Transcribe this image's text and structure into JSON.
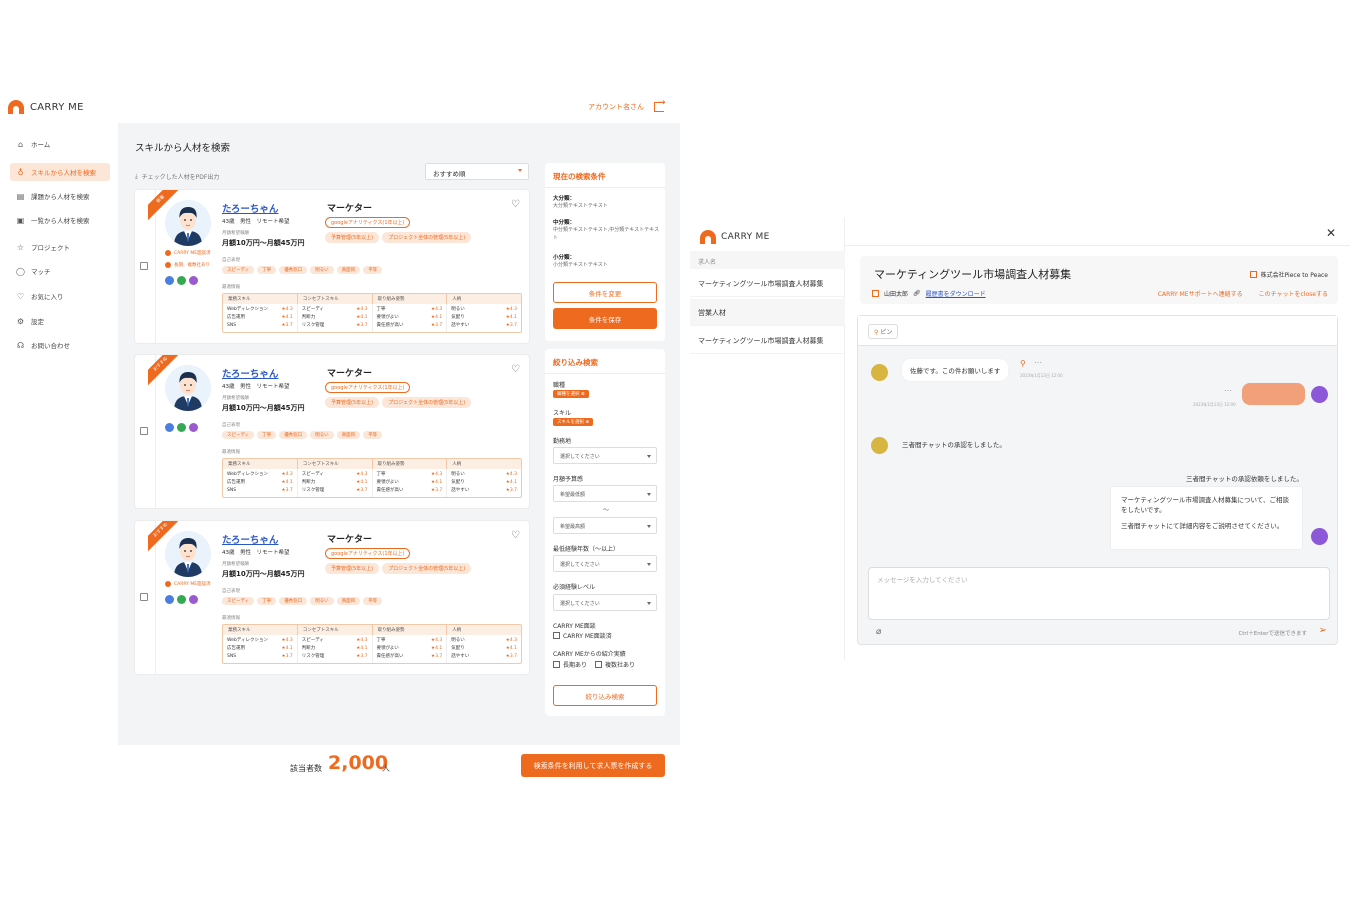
{
  "colors": {
    "accent": "#ee6a1f",
    "accent_soft": "#fbe6d8",
    "link": "#2a56c6"
  },
  "left": {
    "logo_text": "CARRY ME",
    "account_label": "アカウント名さん",
    "nav": [
      {
        "label": "ホーム",
        "icon": "home-icon"
      },
      {
        "label": "スキルから人材を検索",
        "icon": "award-icon",
        "active": true
      },
      {
        "label": "課題から人材を検索",
        "icon": "document-icon"
      },
      {
        "label": "一覧から人材を検索",
        "icon": "profile-card-icon"
      },
      {
        "label": "プロジェクト",
        "icon": "star-icon"
      },
      {
        "label": "マッチ",
        "icon": "chat-bubble-icon"
      },
      {
        "label": "お気に入り",
        "icon": "heart-icon"
      },
      {
        "label": "設定",
        "icon": "gear-icon"
      },
      {
        "label": "お問い合わせ",
        "icon": "headset-icon"
      }
    ],
    "page_title": "スキルから人材を検索",
    "pdf_link": "チェックした人材をPDF出力",
    "sort_value": "おすすめ順",
    "cards": [
      {
        "ribbon": "新着",
        "name": "たろーちゃん",
        "meta": "43歳　男性　リモート希望",
        "salary_label": "月額希望報酬",
        "salary": "月額10万円〜月額45万円",
        "badges": [
          "CARRY ME面談済",
          "長期、複数社あり"
        ],
        "role": "マーケター",
        "role_tags": [
          "googleアナリティクス(1年以上)",
          "予算管理(5年以上)",
          "プロジェクト全体の管理(5年以上)"
        ],
        "trait_label": "自己表現",
        "traits": [
          "スピーディ",
          "丁寧",
          "優秀窓口",
          "明るい",
          "真面目",
          "平等"
        ],
        "skill_label": "最適情報"
      },
      {
        "ribbon": "おすすめ",
        "name": "たろーちゃん",
        "meta": "43歳　男性　リモート希望",
        "salary_label": "月額希望報酬",
        "salary": "月額10万円〜月額45万円",
        "badges": [],
        "role": "マーケター",
        "role_tags": [
          "googleアナリティクス(1年以上)",
          "予算管理(5年以上)",
          "プロジェクト全体の管理(5年以上)"
        ],
        "trait_label": "自己表現",
        "traits": [
          "スピーディ",
          "丁寧",
          "優秀窓口",
          "明るい",
          "真面目",
          "平等"
        ],
        "skill_label": "最適情報"
      },
      {
        "ribbon": "おすすめ",
        "name": "たろーちゃん",
        "meta": "43歳　男性　リモート希望",
        "salary_label": "月額希望報酬",
        "salary": "月額10万円〜月額45万円",
        "badges": [
          "CARRY ME面談済"
        ],
        "role": "マーケター",
        "role_tags": [
          "googleアナリティクス(1年以上)",
          "予算管理(5年以上)",
          "プロジェクト全体の管理(5年以上)"
        ],
        "trait_label": "自己表現",
        "traits": [
          "スピーディ",
          "丁寧",
          "優秀窓口",
          "明るい",
          "真面目",
          "平等"
        ],
        "skill_label": "最適情報"
      }
    ],
    "skill_table": {
      "headers": [
        "業務スキル",
        "コンセプトスキル",
        "取り組み姿勢",
        "人柄"
      ],
      "columns": [
        [
          [
            "Webディレクション",
            "★4.3"
          ],
          [
            "広告運用",
            "★4.1"
          ],
          [
            "SNS",
            "★3.7"
          ]
        ],
        [
          [
            "スピーディ",
            "★4.3"
          ],
          [
            "判断力",
            "★4.1"
          ],
          [
            "リスク管理",
            "★3.7"
          ]
        ],
        [
          [
            "丁寧",
            "★4.3"
          ],
          [
            "要領がよい",
            "★4.1"
          ],
          [
            "責任感が高い",
            "★3.7"
          ]
        ],
        [
          [
            "明るい",
            "★4.3"
          ],
          [
            "気配り",
            "★4.1"
          ],
          [
            "話やすい",
            "★3.7"
          ]
        ]
      ]
    },
    "conditions": {
      "title": "現在の検索条件",
      "items": [
        {
          "label": "大分類：",
          "value": "大分類テキストテキスト"
        },
        {
          "label": "中分類：",
          "value": "中分類テキストテキスト,中分類テキストテキスト"
        },
        {
          "label": "小分類：",
          "value": "小分類テキストテキスト"
        }
      ],
      "change_btn": "条件を変更",
      "save_btn": "条件を保存"
    },
    "filter": {
      "title": "絞り込み検索",
      "job_label": "職種",
      "job_chip": "職種を選択 ⊗",
      "skill_label": "スキル",
      "skill_chip": "スキルを選択 ⊗",
      "location_label": "勤務地",
      "location_value": "選択してください",
      "budget_label": "月額予算感",
      "budget_min": "希望最低額",
      "budget_tilde": "〜",
      "budget_max": "希望最高額",
      "years_label": "最低経験年数（〜以上）",
      "years_value": "選択してください",
      "level_label": "必須経験レベル",
      "level_value": "選択してください",
      "interview_label": "CARRY ME面談",
      "interview_check": "CARRY ME面談済",
      "intro_label": "CARRY MEからの紹介実績",
      "intro_checks": [
        "長期あり",
        "複数社あり"
      ],
      "search_btn": "絞り込み検索"
    },
    "count_label": "該当者数",
    "count_value": "2,000",
    "count_unit": "人",
    "create_btn": "検索条件を利用して求人票を作成する"
  },
  "right": {
    "logo_text": "CARRY ME",
    "col_head": "求人名",
    "items": [
      "マーケティングツール市場調査人材募集",
      "営業人材",
      "マーケティングツール市場調査人材募集"
    ],
    "job_title": "マーケティングツール市場調査人材募集",
    "company": "株式会社Piece to Peace",
    "user": "山田太郎",
    "resume_link": "履歴書をダウンロード",
    "support_link": "CARRY MEサポートへ連絡する",
    "close_link": "このチャットをcloseする",
    "pin_btn": "ピン",
    "msg1": "佐藤です。この件お願いします",
    "msg1_time": "2023年1月13日 12:00",
    "msg2_time": "2023年1月13日 12:00",
    "msg3": "三者間チャットの承認をしました。",
    "msg4_head": "三者間チャットの承認依頼をしました。",
    "msg4_body1": "マーケティングツール市場調査人材募集について、ご相談をしたいです。",
    "msg4_body2": "三者間チャットにて詳細内容をご説明させてください。",
    "input_placeholder": "メッセージを入力してください",
    "send_hint": "Ctrl＋Enterで送信できます",
    "avatar_colors": [
      "#d7b540",
      "#8d58d8"
    ]
  }
}
